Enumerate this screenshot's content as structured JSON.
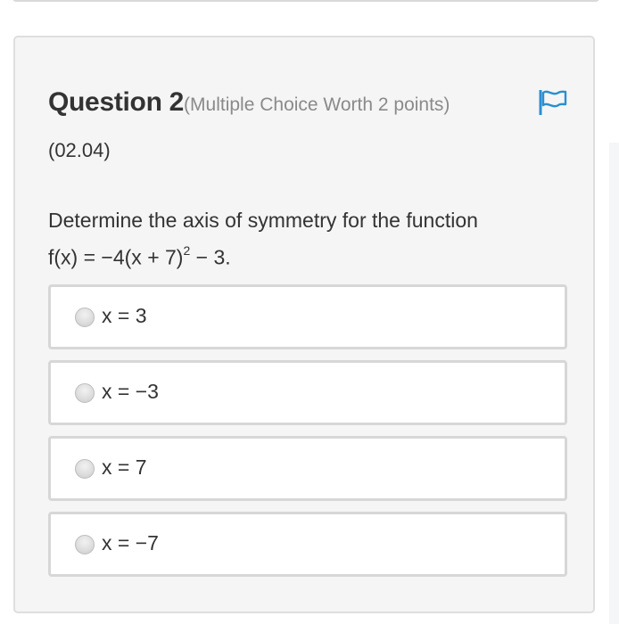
{
  "question": {
    "title": "Question 2",
    "meta": "(Multiple Choice Worth 2 points)",
    "code": "(02.04)",
    "prompt_line1": "Determine the axis of symmetry for the function",
    "prompt_line2_before_exp": "f(x) = −4(x + 7)",
    "prompt_exponent": "2",
    "prompt_line2_after_exp": " − 3."
  },
  "flag": {
    "icon": "flag-icon",
    "color": "#2a8fcf"
  },
  "options": [
    {
      "label": "x = 3",
      "selected": false
    },
    {
      "label": "x = −3",
      "selected": false
    },
    {
      "label": "x = 7",
      "selected": false
    },
    {
      "label": "x = −7",
      "selected": false
    }
  ]
}
